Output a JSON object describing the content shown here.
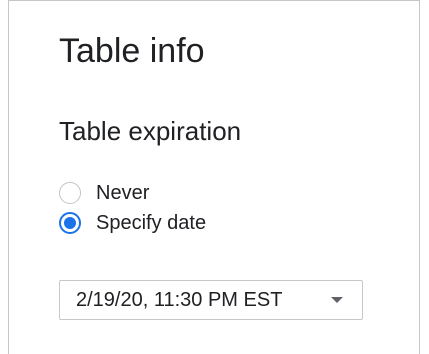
{
  "panel": {
    "title": "Table info"
  },
  "expiration": {
    "heading": "Table expiration",
    "options": [
      {
        "label": "Never",
        "selected": false
      },
      {
        "label": "Specify date",
        "selected": true
      }
    ],
    "date_select": {
      "value": "2/19/20, 11:30 PM EST",
      "icon": "caret-down-icon"
    }
  },
  "colors": {
    "accent": "#1a73e8",
    "text": "#202124",
    "border": "#c7c7c7"
  }
}
